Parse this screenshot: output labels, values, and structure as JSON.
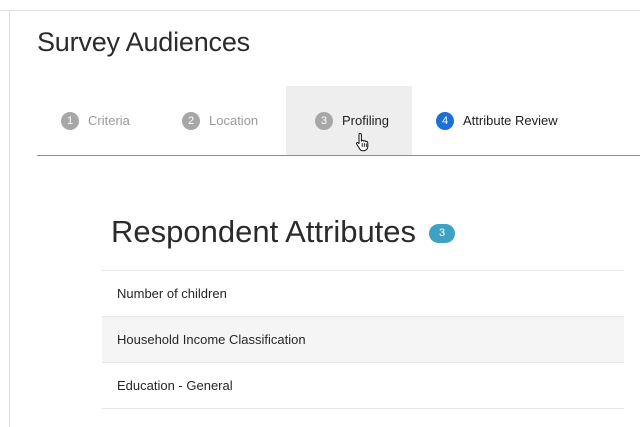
{
  "page": {
    "title": "Survey Audiences"
  },
  "steps": [
    {
      "number": "1",
      "label": "Criteria",
      "state": "inactive"
    },
    {
      "number": "2",
      "label": "Location",
      "state": "inactive"
    },
    {
      "number": "3",
      "label": "Profiling",
      "state": "hovered"
    },
    {
      "number": "4",
      "label": "Attribute Review",
      "state": "current"
    }
  ],
  "section": {
    "title": "Respondent Attributes",
    "count": "3"
  },
  "attributes": [
    {
      "label": "Number of children"
    },
    {
      "label": "Household Income Classification"
    },
    {
      "label": "Education - General"
    }
  ],
  "colors": {
    "current_step": "#1b6fd6",
    "inactive_step": "#a7a7a7",
    "count_badge": "#3fa1c4",
    "hover_bg": "#eeeeee"
  },
  "icons": {
    "pointer": "hand-pointer-icon"
  }
}
